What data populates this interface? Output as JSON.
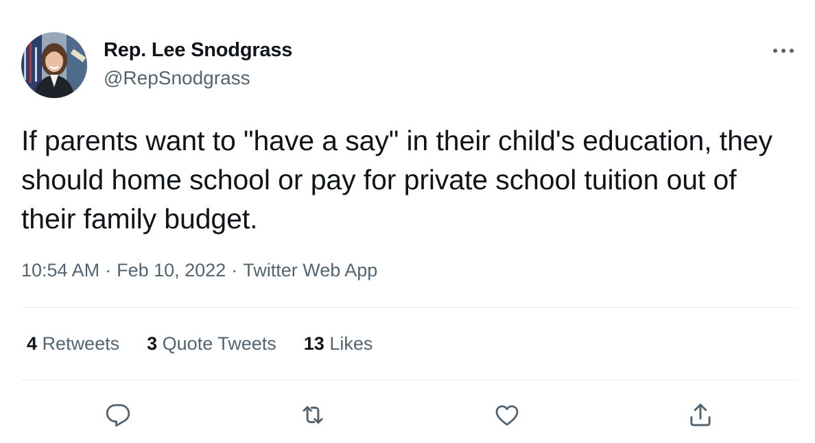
{
  "author": {
    "name": "Rep. Lee Snodgrass",
    "handle": "@RepSnodgrass"
  },
  "tweet": {
    "text": "If parents want to \"have a say\" in their child's education, they should home school or pay for private school tuition out of their family budget."
  },
  "meta": {
    "time": "10:54 AM",
    "separator": "·",
    "date": "Feb 10, 2022",
    "source": "Twitter Web App"
  },
  "stats": {
    "retweets_count": "4",
    "retweets_label": "Retweets",
    "quotes_count": "3",
    "quotes_label": "Quote Tweets",
    "likes_count": "13",
    "likes_label": "Likes"
  },
  "icons": {
    "more": "more-dots-icon",
    "reply": "reply-icon",
    "retweet": "retweet-icon",
    "like": "heart-icon",
    "share": "share-icon"
  },
  "colors": {
    "text": "#0f1419",
    "secondary": "#536471",
    "divider": "#e6ecf0",
    "icon": "#536471"
  }
}
